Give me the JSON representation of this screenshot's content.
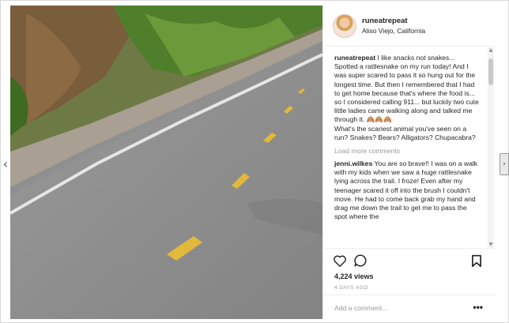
{
  "colors": {
    "text": "#262626",
    "muted": "#999999",
    "border": "#efefef"
  },
  "post": {
    "username": "runeatrepeat",
    "location": "Aliso Viejo, California",
    "caption_author": "runeatrepeat",
    "caption": "I like snacks not snakes...\nSpotted a rattlesnake on my run today! And I was super scared to pass it so hung out for the longest time. But then I remembered that I had to get home because that's where the food is... so I considered calling 911... but luckily two cute little ladies came walking along and talked me through it. 🙈🙈🙈\nWhat's the scariest animal you've seen on a run? Snakes? Bears? Alligators? Chupacabra?",
    "load_more": "Load more comments",
    "comment_author": "jenni.wilkes",
    "comment_text": "You are so brave!! I was on a walk with my kids when we saw a huge rattlesnake lying across the trail. I froze! Even after my teenager scared it off into the brush I couldn't move. He had to come back grab my hand and drag me down the trail to get me to pass the spot where the",
    "views": "4,224 views",
    "time_ago": "4 DAYS AGO",
    "add_comment_placeholder": "Add a comment...",
    "more_label": "•••"
  },
  "icons": {
    "prev": "chevron-left-icon",
    "next": "chevron-right-icon",
    "like": "heart-icon",
    "comment": "comment-bubble-icon",
    "save": "bookmark-icon",
    "more": "more-dots-icon"
  },
  "nav": {
    "prev_glyph": "‹",
    "next_glyph": "›"
  }
}
